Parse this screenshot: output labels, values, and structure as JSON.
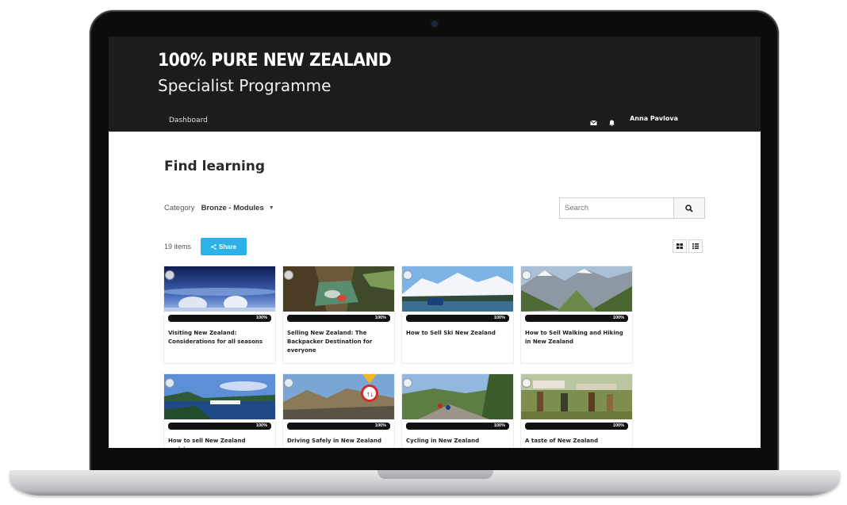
{
  "header": {
    "brand": "100% PURE NEW ZEALAND",
    "programme": "Specialist Programme",
    "nav_dashboard": "Dashboard",
    "user_name": "Anna Pavlova"
  },
  "main": {
    "title": "Find learning",
    "category_label": "Category",
    "category_value": "Bronze - Modules",
    "search_placeholder": "Search",
    "count": "19 items",
    "share_label": "Share"
  },
  "colors": {
    "header_bg": "#1c1c1c",
    "accent": "#2bb0e8",
    "progress_bar": "#111111"
  },
  "cards": [
    {
      "title": "Visiting New Zealand: Considerations for all seasons",
      "progress_label": "100%",
      "progress": 1.0
    },
    {
      "title": "Selling New Zealand: The Backpacker Destination for everyone",
      "progress_label": "100%",
      "progress": 1.0
    },
    {
      "title": "How to Sell Ski New Zealand",
      "progress_label": "100%",
      "progress": 1.0
    },
    {
      "title": "How to Sell Walking and Hiking in New Zealand",
      "progress_label": "100%",
      "progress": 1.0
    },
    {
      "title": "How to sell New Zealand cruising",
      "progress_label": "100%",
      "progress": 1.0
    },
    {
      "title": "Driving Safely in New Zealand",
      "progress_label": "100%",
      "progress": 1.0
    },
    {
      "title": "Cycling in New Zealand",
      "progress_label": "100%",
      "progress": 1.0
    },
    {
      "title": "A taste of New Zealand",
      "progress_label": "100%",
      "progress": 1.0
    }
  ]
}
